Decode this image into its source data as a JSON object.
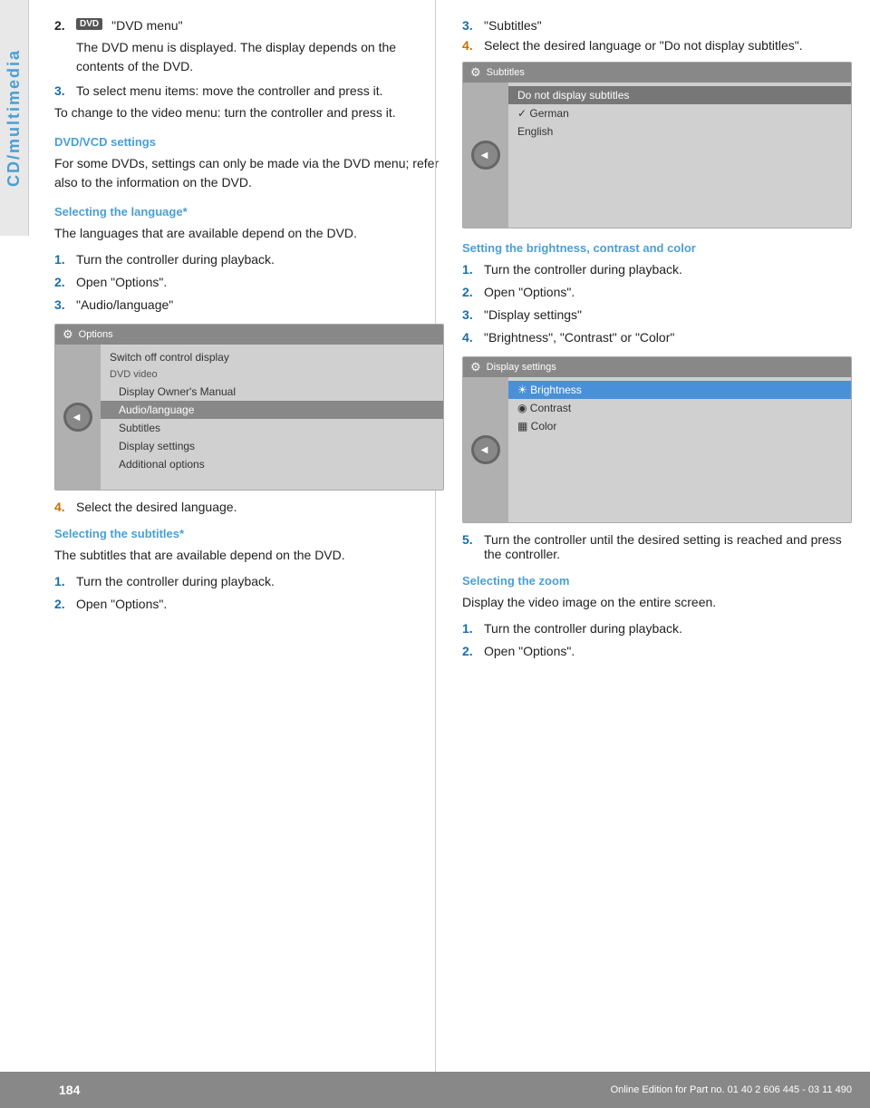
{
  "sidebar": {
    "label": "CD/multimedia"
  },
  "page": {
    "number": "184",
    "footer": "Online Edition for Part no. 01 40 2 606 445 - 03 11 490"
  },
  "left_col": {
    "step2": {
      "icon": "DVD",
      "text": "\"DVD menu\""
    },
    "step2_desc": "The DVD menu is displayed. The display depends on the contents of the DVD.",
    "step3": {
      "text": "To select menu items: move the controller and press it."
    },
    "change_note": "To change to the video menu: turn the controller and press it.",
    "dvd_vcd_heading": "DVD/VCD settings",
    "dvd_vcd_desc": "For some DVDs, settings can only be made via the DVD menu; refer also to the information on the DVD.",
    "language_heading": "Selecting the language*",
    "language_desc": "The languages that are available depend on the DVD.",
    "lang_steps": [
      {
        "num": "1.",
        "text": "Turn the controller during playback."
      },
      {
        "num": "2.",
        "text": "Open \"Options\"."
      },
      {
        "num": "3.",
        "text": "\"Audio/language\""
      }
    ],
    "options_mockup": {
      "title": "Options",
      "items": [
        {
          "text": "Switch off control display",
          "type": "normal"
        },
        {
          "text": "DVD video",
          "type": "section-label"
        },
        {
          "text": "Display Owner's Manual",
          "type": "indented"
        },
        {
          "text": "Audio/language",
          "type": "highlighted indented"
        },
        {
          "text": "Subtitles",
          "type": "indented"
        },
        {
          "text": "Display settings",
          "type": "indented"
        },
        {
          "text": "Additional options",
          "type": "indented"
        }
      ]
    },
    "step4_lang": {
      "num": "4.",
      "text": "Select the desired language."
    },
    "subtitles_heading": "Selecting the subtitles*",
    "subtitles_desc": "The subtitles that are available depend on the DVD.",
    "subtitle_steps": [
      {
        "num": "1.",
        "text": "Turn the controller during playback."
      },
      {
        "num": "2.",
        "text": "Open \"Options\"."
      }
    ]
  },
  "right_col": {
    "step3_sub": {
      "num": "3.",
      "text": "\"Subtitles\""
    },
    "step4_sub": {
      "num": "4.",
      "text": "Select the desired language or \"Do not display subtitles\"."
    },
    "subtitles_mockup": {
      "title": "Subtitles",
      "items": [
        {
          "text": "Do not display subtitles",
          "type": "highlighted"
        },
        {
          "text": "✓ German",
          "type": "normal"
        },
        {
          "text": "English",
          "type": "normal"
        }
      ]
    },
    "brightness_heading": "Setting the brightness, contrast and color",
    "brightness_steps": [
      {
        "num": "1.",
        "text": "Turn the controller during playback."
      },
      {
        "num": "2.",
        "text": "Open \"Options\"."
      },
      {
        "num": "3.",
        "text": "\"Display settings\""
      },
      {
        "num": "4.",
        "text": "\"Brightness\", \"Contrast\" or \"Color\""
      }
    ],
    "display_mockup": {
      "title": "Display settings",
      "items": [
        {
          "text": "☀ Brightness",
          "type": "highlighted"
        },
        {
          "text": "◉ Contrast",
          "type": "normal"
        },
        {
          "text": "▦ Color",
          "type": "normal"
        }
      ]
    },
    "step5_brightness": {
      "num": "5.",
      "text": "Turn the controller until the desired setting is reached and press the controller."
    },
    "zoom_heading": "Selecting the zoom",
    "zoom_desc": "Display the video image on the entire screen.",
    "zoom_steps": [
      {
        "num": "1.",
        "text": "Turn the controller during playback."
      },
      {
        "num": "2.",
        "text": "Open \"Options\"."
      }
    ]
  }
}
